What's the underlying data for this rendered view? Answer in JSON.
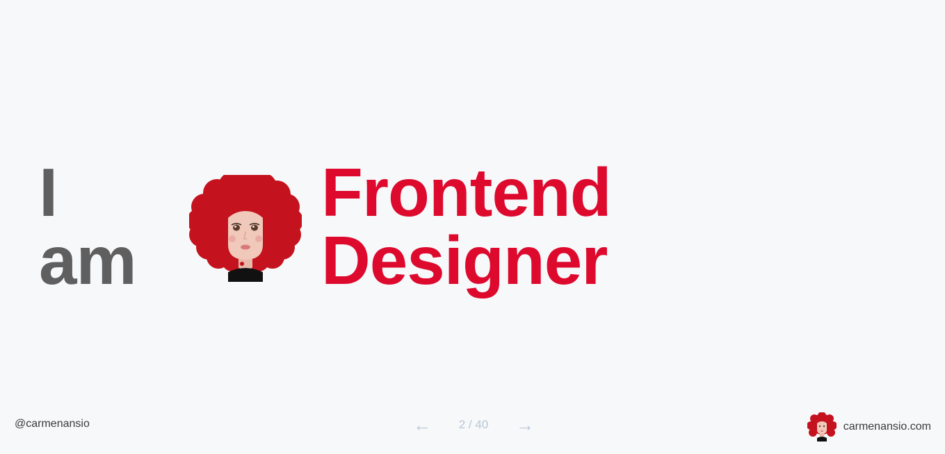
{
  "intro": {
    "line1": "I",
    "line2": "am"
  },
  "role": {
    "line1": "Frontend",
    "line2": "Designer"
  },
  "footer": {
    "handle": "@carmenansio",
    "pager": {
      "prev_icon": "arrow-left-icon",
      "current": "2 / 40",
      "next_icon": "arrow-right-icon"
    },
    "site": "carmenansio.com"
  },
  "colors": {
    "background": "#f7f8fa",
    "intro_text": "#5f5f5f",
    "accent_red": "#dd0a2e",
    "hair_red": "#c4121e",
    "pager_gray": "#b8c6d4"
  }
}
